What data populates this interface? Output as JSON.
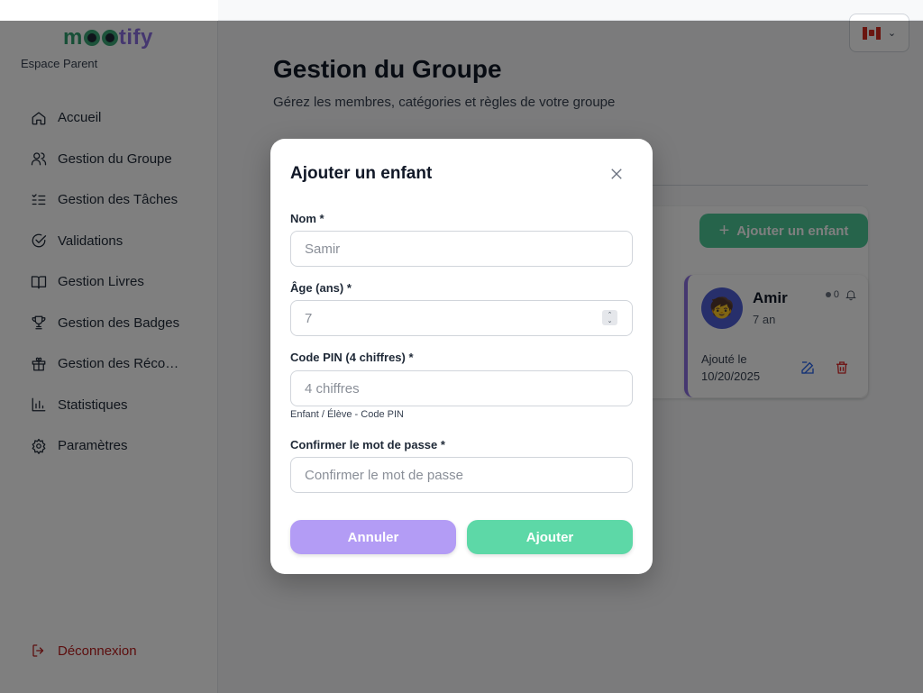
{
  "brand": {
    "logo_m": "m",
    "logo_tail": "tify",
    "space_label": "Espace Parent"
  },
  "sidebar": {
    "items": [
      {
        "label": "Accueil",
        "icon": "home-icon"
      },
      {
        "label": "Gestion du Groupe",
        "icon": "users-icon"
      },
      {
        "label": "Gestion des Tâches",
        "icon": "list-check-icon"
      },
      {
        "label": "Validations",
        "icon": "check-circle-icon"
      },
      {
        "label": "Gestion Livres",
        "icon": "book-icon"
      },
      {
        "label": "Gestion des Badges",
        "icon": "trophy-icon"
      },
      {
        "label": "Gestion des Réco…",
        "icon": "gift-icon"
      },
      {
        "label": "Statistiques",
        "icon": "bar-chart-icon"
      },
      {
        "label": "Paramètres",
        "icon": "gear-icon"
      }
    ],
    "logout_label": "Déconnexion"
  },
  "header": {
    "language": "Canada flag",
    "chevron": "⌄"
  },
  "page": {
    "title": "Gestion du Groupe",
    "subtitle": "Gérez les membres, catégories et règles de votre groupe",
    "add_child_label": "Ajouter un enfant",
    "add_child_plus": "+"
  },
  "child": {
    "avatar": "🧒",
    "name": "Amir",
    "age": "7 an",
    "count": "0",
    "added_line1": "Ajouté le",
    "added_line2": "10/20/2025"
  },
  "modal": {
    "title": "Ajouter un enfant",
    "name_label": "Nom *",
    "name_placeholder": "Samir",
    "age_label": "Âge (ans) *",
    "age_placeholder": "7",
    "pin_label": "Code PIN (4 chiffres) *",
    "pin_placeholder": "4 chiffres",
    "pin_hint": "Enfant / Élève - Code PIN",
    "confirm_label": "Confirmer le mot de passe *",
    "confirm_placeholder": "Confirmer le mot de passe",
    "cancel_label": "Annuler",
    "submit_label": "Ajouter",
    "spin_up": "⌃",
    "spin_down": "⌄"
  },
  "colors": {
    "accent_green": "#4cc897",
    "accent_purple": "#8b6fe0",
    "danger": "#b91c1c"
  }
}
